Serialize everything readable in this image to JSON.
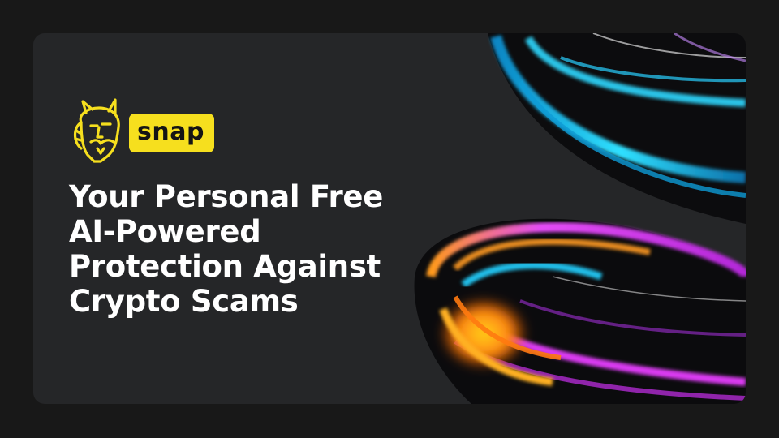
{
  "brand": {
    "name": "snap",
    "badge_color": "#f6df1e",
    "mascot_icon": "mascot-face-icon"
  },
  "headline": {
    "lines": [
      "Your Personal Free",
      "AI-Powered",
      "Protection Against",
      "Crypto Scams"
    ]
  },
  "colors": {
    "background": "#181818",
    "card": "#252628",
    "text": "#ffffff",
    "accent_cyan": "#19c8f0",
    "accent_magenta": "#d93bf0",
    "accent_orange": "#ff8a1a"
  }
}
